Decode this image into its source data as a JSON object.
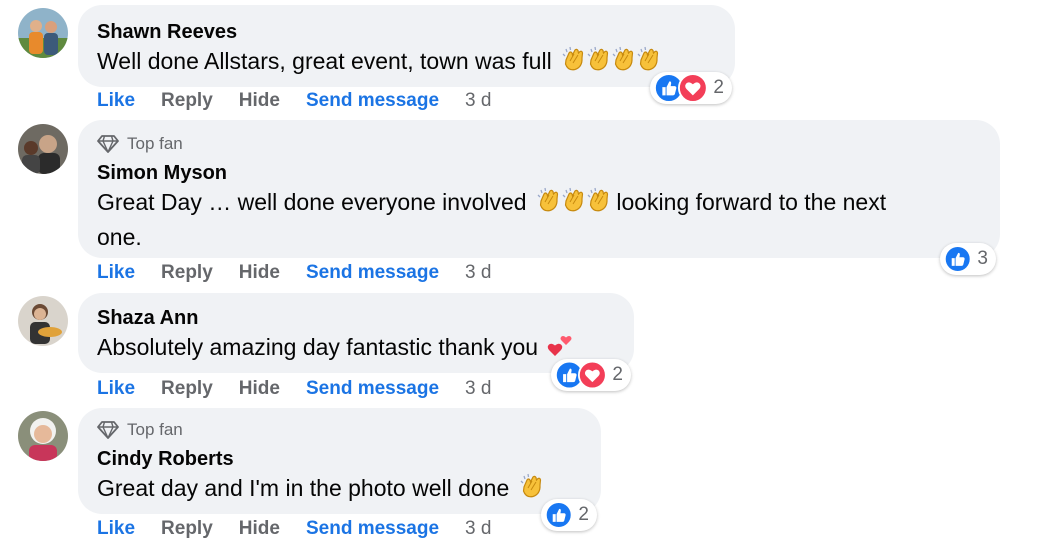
{
  "colors": {
    "accent": "#1b74e4",
    "bubble": "#f0f2f5",
    "meta": "#65676b",
    "like": "#1877f2",
    "love": "#f33e58"
  },
  "comments": [
    {
      "author": "Shawn Reeves",
      "badge": "",
      "text": "Well done Allstars, great event, town was full",
      "emoji": [
        "clapping-hands",
        "clapping-hands",
        "clapping-hands",
        "clapping-hands"
      ],
      "reactions": [
        "like",
        "love"
      ],
      "reaction_count": "2",
      "actions": {
        "like": "Like",
        "reply": "Reply",
        "hide": "Hide",
        "send": "Send message",
        "time": "3 d"
      }
    },
    {
      "author": "Simon Myson",
      "badge": "Top fan",
      "text_before": "Great Day … well done everyone involved",
      "emoji": [
        "clapping-hands",
        "clapping-hands",
        "clapping-hands"
      ],
      "text_after": "looking forward to the next",
      "text_line2": "one.",
      "reactions": [
        "like"
      ],
      "reaction_count": "3",
      "actions": {
        "like": "Like",
        "reply": "Reply",
        "hide": "Hide",
        "send": "Send message",
        "time": "3 d"
      }
    },
    {
      "author": "Shaza Ann",
      "badge": "",
      "text": "Absolutely amazing day fantastic thank you",
      "emoji": [
        "two-hearts"
      ],
      "reactions": [
        "like",
        "love"
      ],
      "reaction_count": "2",
      "actions": {
        "like": "Like",
        "reply": "Reply",
        "hide": "Hide",
        "send": "Send message",
        "time": "3 d"
      }
    },
    {
      "author": "Cindy Roberts",
      "badge": "Top fan",
      "text": "Great day and I'm in the photo well done",
      "emoji": [
        "clapping-hands"
      ],
      "reactions": [
        "like"
      ],
      "reaction_count": "2",
      "actions": {
        "like": "Like",
        "reply": "Reply",
        "hide": "Hide",
        "send": "Send message",
        "time": "3 d"
      }
    }
  ]
}
